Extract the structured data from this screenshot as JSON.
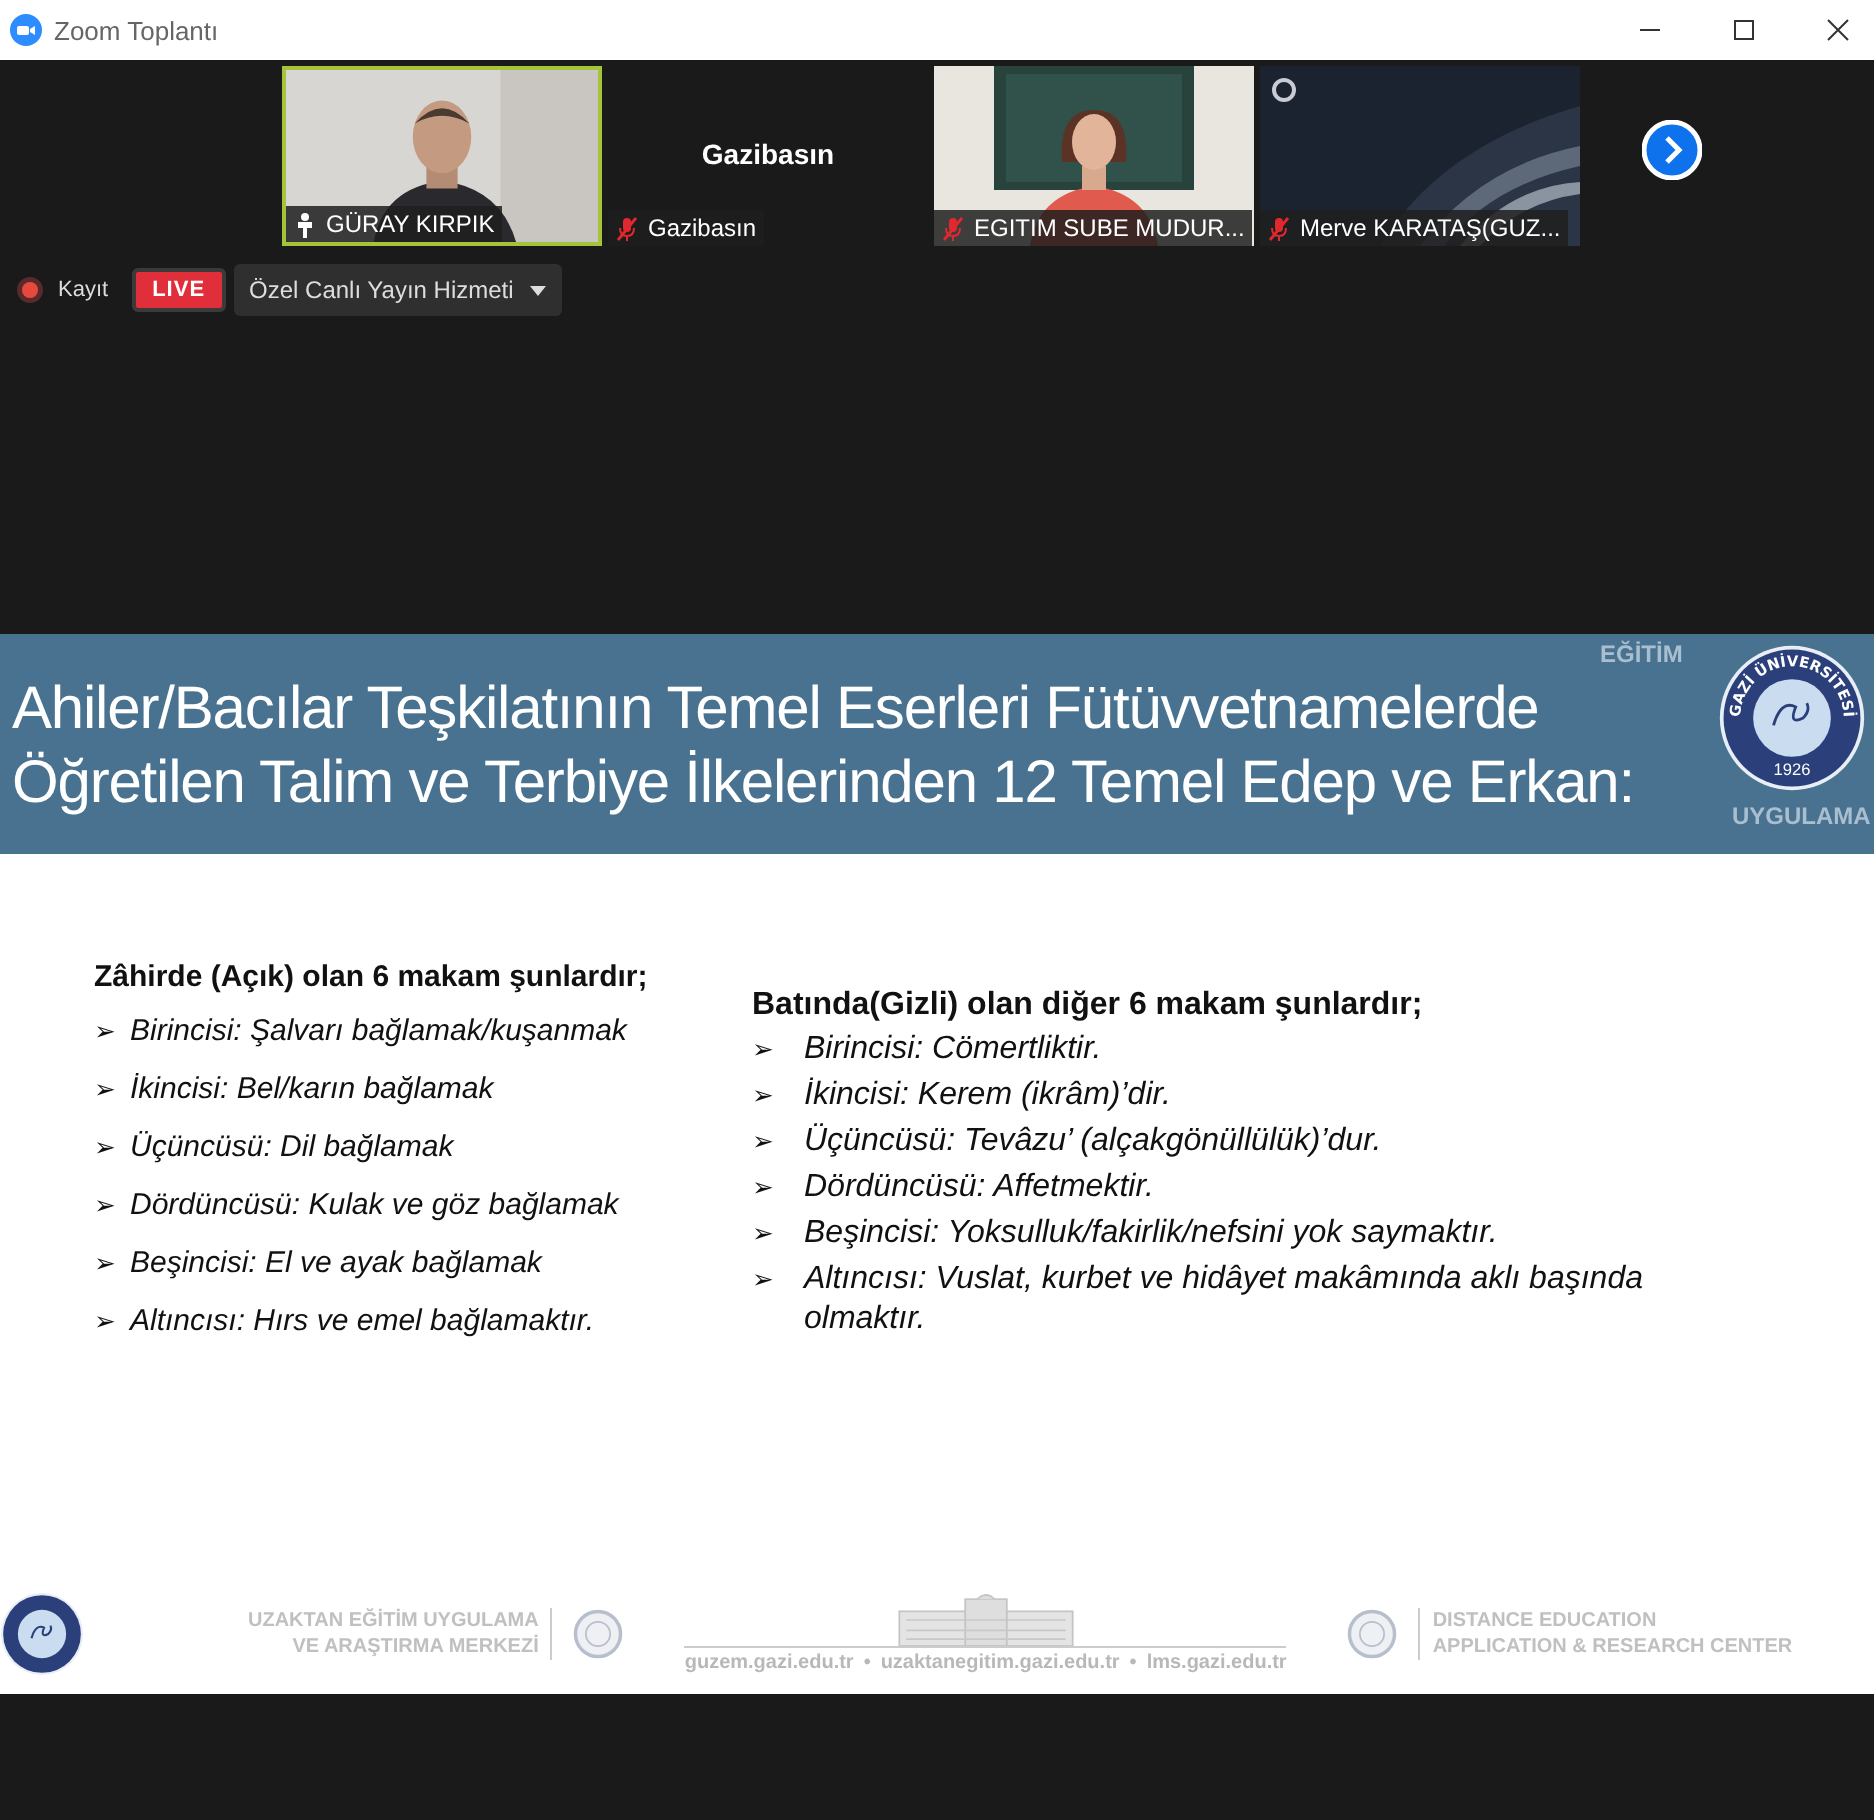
{
  "window": {
    "title": "Zoom Toplantı"
  },
  "participants": [
    {
      "kind": "video",
      "name_tag": {
        "kind": "pin",
        "text": "GÜRAY KIRPIK"
      },
      "selected": true
    },
    {
      "kind": "name",
      "display_name": "Gazibasın",
      "name_tag": {
        "kind": "mic_off",
        "text": "Gazibasın"
      },
      "selected": false
    },
    {
      "kind": "video",
      "name_tag": {
        "kind": "mic_off",
        "text": "EGITIM SUBE MUDUR..."
      },
      "selected": false
    },
    {
      "kind": "screen",
      "name_tag": {
        "kind": "mic_off",
        "text": "Merve KARATAŞ(GUZ..."
      },
      "selected": false
    }
  ],
  "recording": {
    "label": "Kayıt",
    "live_badge": "LIVE",
    "stream_menu": "Özel Canlı Yayın Hizmeti"
  },
  "slide": {
    "title_lines": [
      "Ahiler/Bacılar Teşkilatının Temel Eserleri Fütüvvetnamelerde",
      "Öğretilen Talim ve Terbiye İlkelerinden 12 Temel Edep ve Erkan:"
    ],
    "decor_words": [
      "EĞİTİM",
      "UYGULAMA"
    ],
    "seal": {
      "name": "GAZİ ÜNİVERSİTESİ",
      "year": "1926"
    },
    "columns": [
      {
        "heading": "Zâhirde (Açık) olan 6 makam şunlardır;",
        "bullet": "➢",
        "items": [
          "Birincisi: Şalvarı bağlamak/kuşanmak",
          "İkincisi: Bel/karın bağlamak",
          "Üçüncüsü: Dil bağlamak",
          "Dördüncüsü: Kulak ve göz bağlamak",
          "Beşincisi: El ve ayak bağlamak",
          "Altıncısı: Hırs ve emel bağlamaktır."
        ]
      },
      {
        "heading": "Batında(Gizli) olan diğer 6 makam şunlardır;",
        "bullet": "➢",
        "items": [
          "Birincisi: Cömertliktir.",
          "İkincisi: Kerem (ikrâm)’dir.",
          "Üçüncüsü: Tevâzu’ (alçakgönüllülük)’dur.",
          "Dördüncüsü: Affetmektir.",
          "Beşincisi: Yoksulluk/fakirlik/nefsini yok saymaktır.",
          "Altıncısı: Vuslat, kurbet ve hidâyet makâmında aklı başında olmaktır."
        ]
      }
    ],
    "footer": {
      "center_tr": [
        "UZAKTAN EĞİTİM UYGULAMA",
        "VE ARAŞTIRMA MERKEZİ"
      ],
      "links": [
        "guzem.gazi.edu.tr",
        "uzaktanegitim.gazi.edu.tr",
        "lms.gazi.edu.tr"
      ],
      "separator": "•",
      "center_en": [
        "DISTANCE EDUCATION",
        "APPLICATION & RESEARCH CENTER"
      ]
    }
  }
}
